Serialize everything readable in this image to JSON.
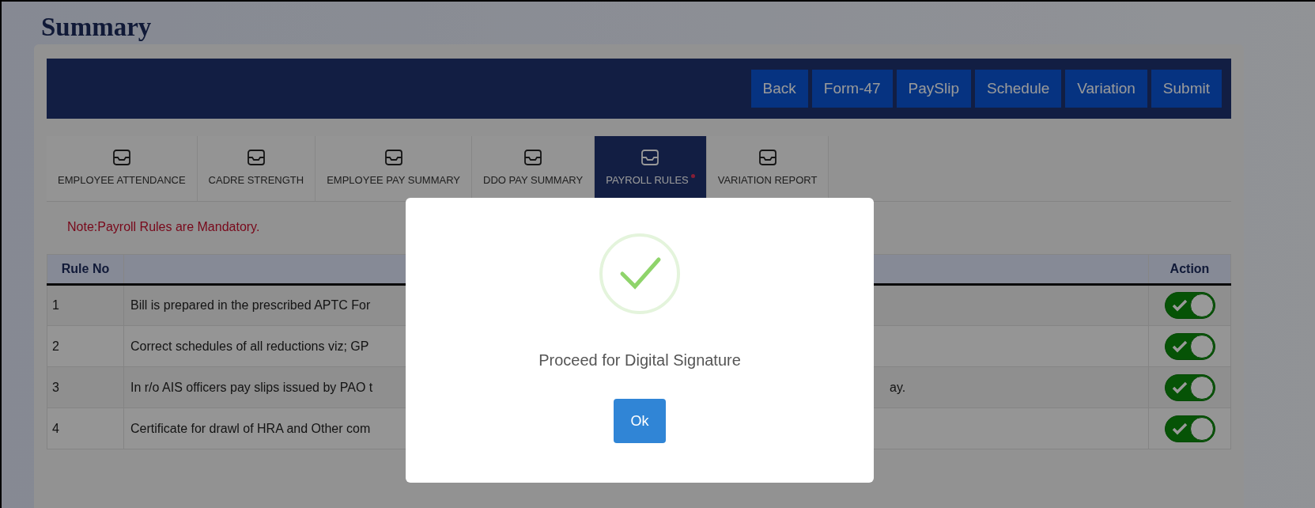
{
  "page": {
    "title": "Summary"
  },
  "toolbar_buttons": [
    "Back",
    "Form-47",
    "PaySlip",
    "Schedule",
    "Variation",
    "Submit"
  ],
  "tabs": [
    {
      "label": "EMPLOYEE ATTENDANCE",
      "selected": false,
      "required": false
    },
    {
      "label": "CADRE STRENGTH",
      "selected": false,
      "required": false
    },
    {
      "label": "EMPLOYEE PAY SUMMARY",
      "selected": false,
      "required": false
    },
    {
      "label": "DDO PAY SUMMARY",
      "selected": false,
      "required": false
    },
    {
      "label": "PAYROLL RULES",
      "selected": true,
      "required": true
    },
    {
      "label": "VARIATION REPORT",
      "selected": false,
      "required": false
    }
  ],
  "note": "Note:Payroll Rules are Mandatory.",
  "table": {
    "columns": [
      "Rule No",
      "Action"
    ],
    "rows": [
      {
        "rule_no": "1",
        "description": "Bill is prepared in the prescribed APTC For",
        "on": true
      },
      {
        "rule_no": "2",
        "description": "Correct schedules of all reductions viz; GP",
        "on": true
      },
      {
        "rule_no": "3",
        "description": "In r/o AIS officers pay slips issued by PAO t",
        "description_tail": "ay.",
        "on": true
      },
      {
        "rule_no": "4",
        "description": "Certificate for drawl of HRA and Other com",
        "on": true
      }
    ]
  },
  "dialog": {
    "message": "Proceed for Digital Signature",
    "button": "Ok"
  }
}
